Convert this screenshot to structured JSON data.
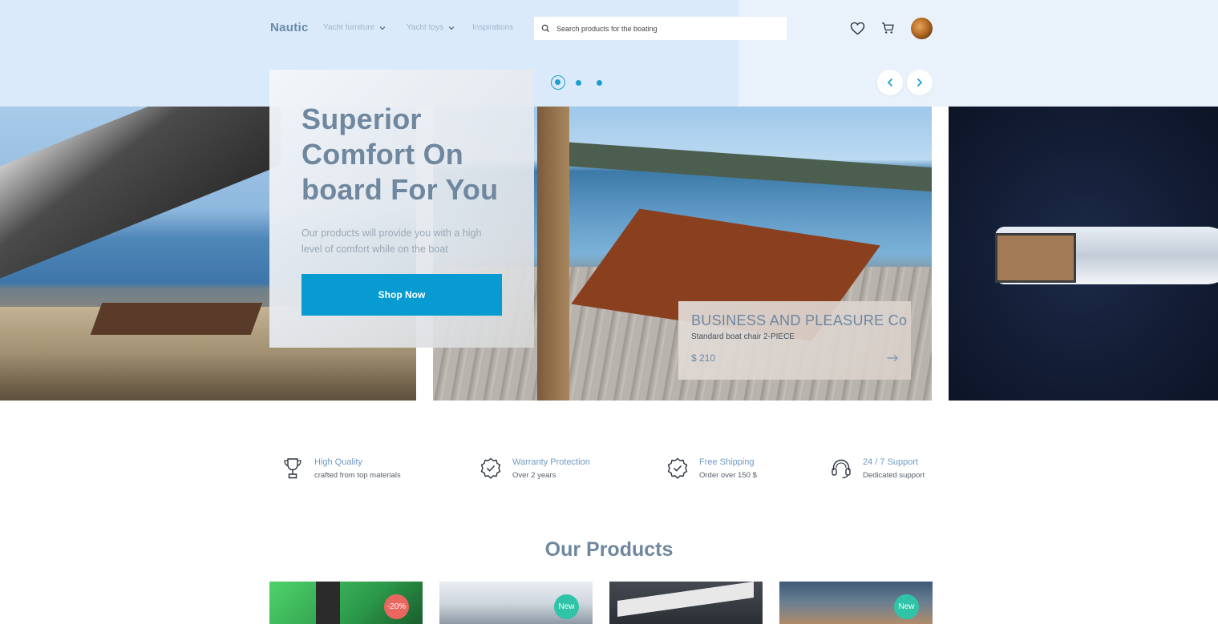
{
  "header": {
    "logo": "Nautic",
    "nav": [
      {
        "label": "Yacht furniture",
        "has_dropdown": true
      },
      {
        "label": "Yacht toys",
        "has_dropdown": true
      },
      {
        "label": "Inspirations",
        "has_dropdown": false
      }
    ],
    "search": {
      "placeholder": "Search products for the boating",
      "value": ""
    },
    "icons": [
      "heart-icon",
      "cart-icon",
      "avatar"
    ]
  },
  "slider": {
    "dots": 3,
    "active_dot": 1,
    "prev_icon": "chevron-left-icon",
    "next_icon": "chevron-right-icon"
  },
  "hero": {
    "title": "Superior Comfort On board For You",
    "subtitle": "Our products will provide you with a high level of comfort while on the boat",
    "cta": "Shop Now"
  },
  "featured_product": {
    "brand": "BUSINESS AND PLEASURE Co",
    "name": "Standard boat chair 2-PIECE",
    "price": "$ 210",
    "icon": "arrow-right-icon"
  },
  "features": [
    {
      "icon": "trophy-icon",
      "title": "High Quality",
      "subtitle": "crafted from top materials"
    },
    {
      "icon": "badge-check-icon",
      "title": "Warranty Protection",
      "subtitle": "Over 2 years"
    },
    {
      "icon": "badge-check-icon",
      "title": "Free Shipping",
      "subtitle": "Order over 150 $"
    },
    {
      "icon": "headset-icon",
      "title": "24 / 7 Support",
      "subtitle": "Dedicated support"
    }
  ],
  "products_section": {
    "title": "Our Products",
    "items": [
      {
        "badge": "-20%",
        "badge_type": "sale"
      },
      {
        "badge": "New",
        "badge_type": "new"
      },
      {
        "badge": "",
        "badge_type": ""
      },
      {
        "badge": "New",
        "badge_type": "new"
      }
    ]
  },
  "colors": {
    "accent": "#089bd2",
    "title": "#6f879f",
    "sale_badge": "#e9675f",
    "new_badge": "#2fc4a8",
    "header_bg": "#dbeafa"
  }
}
